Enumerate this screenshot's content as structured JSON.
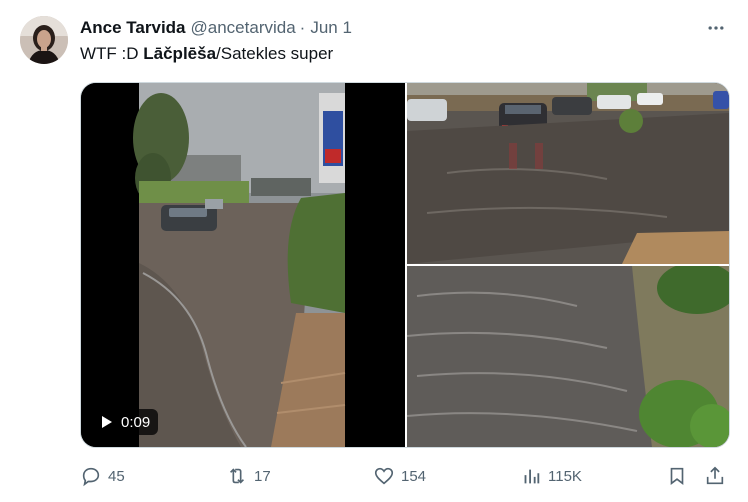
{
  "author": {
    "name": "Ance Tarvida",
    "handle": "@ancetarvida",
    "separator": "·",
    "date": "Jun 1"
  },
  "tweet": {
    "text_prefix": "WTF :D ",
    "text_bold": "Lāčplēša",
    "text_suffix": "/Satekles super"
  },
  "media": {
    "video_duration": "0:09"
  },
  "actions": {
    "replies": "45",
    "reposts": "17",
    "likes": "154",
    "views": "115K"
  },
  "icons": {
    "more": "more-icon",
    "play": "play-icon",
    "reply": "reply-icon",
    "repost": "repost-icon",
    "like": "like-icon",
    "views": "views-icon",
    "bookmark": "bookmark-icon",
    "share": "share-icon"
  },
  "colors": {
    "text": "#0f1419",
    "secondary": "#536471",
    "border": "#cfd9de"
  }
}
